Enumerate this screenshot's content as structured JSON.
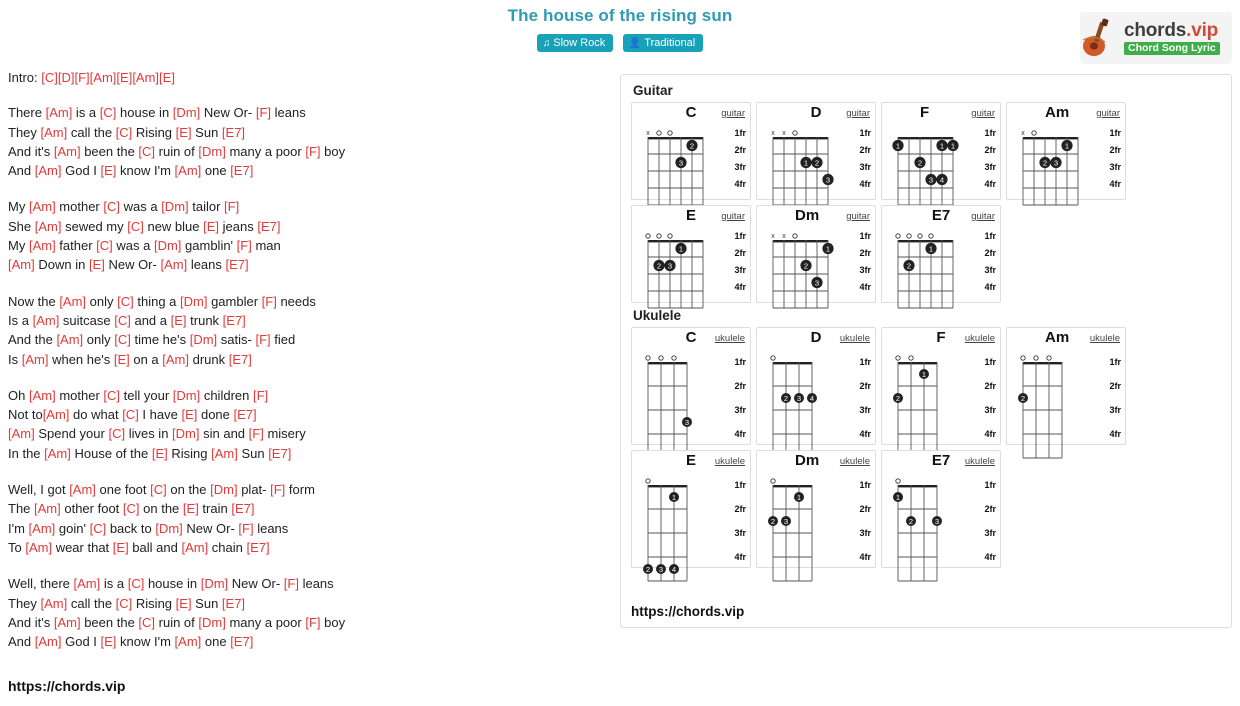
{
  "title": "The house of the rising sun",
  "badges": [
    {
      "icon": "metronome-icon",
      "label": "Slow Rock"
    },
    {
      "icon": "user-icon",
      "label": "Traditional"
    }
  ],
  "brand": {
    "name_main": "chords",
    "name_tld": ".vip",
    "tagline": "Chord Song Lyric",
    "icon": "ukulele-icon"
  },
  "site_link": "https://chords.vip",
  "panel_link": "https://chords.vip",
  "intro": "Intro: [C][D][F][Am][E][Am][E]",
  "verses": [
    [
      "There [Am] is a [C] house in [Dm] New Or- [F] leans",
      "They [Am] call the [C] Rising [E] Sun [E7]",
      "And it's [Am] been the [C] ruin of [Dm] many a poor [F] boy",
      "And [Am] God I [E] know I'm [Am] one [E7]"
    ],
    [
      "My [Am] mother [C] was a [Dm] tailor [F]",
      "She [Am] sewed my [C] new blue [E] jeans [E7]",
      "My [Am] father [C] was a [Dm] gamblin' [F] man",
      "[Am] Down in [E] New Or- [Am] leans [E7]"
    ],
    [
      "Now the [Am] only [C] thing a [Dm] gambler [F] needs",
      "Is a [Am] suitcase [C] and a [E] trunk [E7]",
      "And the [Am] only [C] time he's [Dm] satis- [F] fied",
      "Is [Am] when he's [E] on a [Am] drunk [E7]"
    ],
    [
      "Oh [Am] mother [C] tell your [Dm] children [F]",
      "Not to[Am] do what [C] I have [E] done [E7]",
      "[Am] Spend your [C] lives in [Dm] sin and [F] misery",
      "In the [Am] House of the [E] Rising [Am] Sun [E7]"
    ],
    [
      "Well, I got [Am] one foot [C] on the [Dm] plat- [F] form",
      "The [Am] other foot [C] on the [E] train [E7]",
      "I'm [Am] goin' [C] back to [Dm] New Or- [F] leans",
      "To [Am] wear that [E] ball and [Am] chain [E7]"
    ],
    [
      "Well, there [Am] is a [C] house in [Dm] New Or- [F] leans",
      "They [Am] call the [C] Rising [E] Sun [E7]",
      "And it's [Am] been the [C] ruin of [Dm] many a poor [F] boy",
      "And [Am] God I [E] know I'm [Am] one [E7]"
    ]
  ],
  "fret_labels": [
    "1fr",
    "2fr",
    "3fr",
    "4fr"
  ],
  "sections": [
    {
      "title": "Guitar",
      "instrument_label": "guitar",
      "rows": [
        [
          {
            "name": "C",
            "top": "x      o      o",
            "dots": [
              [
                1,
                "2",
                2
              ],
              [
                2,
                "3",
                3
              ]
            ],
            "label_shift": false
          },
          {
            "name": "D",
            "top": "x  x   o",
            "dots": [
              [
                2,
                "1",
                3
              ],
              [
                2,
                "2",
                2
              ],
              [
                3,
                "3",
                1
              ]
            ],
            "label_shift": false
          },
          {
            "name": "F",
            "top": "",
            "dots": [
              [
                1,
                "1",
                6
              ],
              [
                1,
                "1",
                2
              ],
              [
                1,
                "1",
                1
              ],
              [
                2,
                "2",
                4
              ],
              [
                3,
                "3",
                3
              ],
              [
                3,
                "4",
                2
              ]
            ],
            "label_shift": true
          },
          {
            "name": "Am",
            "top": "x  o",
            "dots": [
              [
                1,
                "1",
                2
              ],
              [
                2,
                "2",
                4
              ],
              [
                2,
                "3",
                3
              ]
            ],
            "label_shift": true
          }
        ],
        [
          {
            "name": "E",
            "top": "o        o  o",
            "dots": [
              [
                1,
                "1",
                3
              ],
              [
                2,
                "2",
                5
              ],
              [
                2,
                "3",
                4
              ]
            ],
            "label_shift": false
          },
          {
            "name": "Dm",
            "top": "x  x   o",
            "dots": [
              [
                1,
                "1",
                1
              ],
              [
                2,
                "2",
                3
              ],
              [
                3,
                "3",
                2
              ]
            ],
            "label_shift": true
          },
          {
            "name": "E7",
            "top": "o     o     o  o",
            "dots": [
              [
                1,
                "1",
                3
              ],
              [
                2,
                "2",
                5
              ]
            ],
            "label_shift": false
          }
        ]
      ]
    },
    {
      "title": "Ukulele",
      "instrument_label": "ukulele",
      "rows": [
        [
          {
            "name": "C",
            "top": "o  o  o",
            "dots": [
              [
                3,
                "3",
                1
              ]
            ],
            "label_shift": false
          },
          {
            "name": "D",
            "top": "o",
            "dots": [
              [
                2,
                "2",
                3
              ],
              [
                2,
                "3",
                2
              ],
              [
                2,
                "4",
                1
              ]
            ],
            "label_shift": false
          },
          {
            "name": "F",
            "top": "o  o",
            "dots": [
              [
                1,
                "1",
                2
              ],
              [
                2,
                "2",
                4
              ]
            ],
            "label_shift": false
          },
          {
            "name": "Am",
            "top": "o  o  o",
            "dots": [
              [
                2,
                "2",
                4
              ]
            ],
            "label_shift": true
          }
        ],
        [
          {
            "name": "E",
            "top": "o",
            "dots": [
              [
                1,
                "1",
                2
              ],
              [
                4,
                "2",
                4
              ],
              [
                4,
                "3",
                3
              ],
              [
                4,
                "4",
                2
              ]
            ],
            "label_shift": false
          },
          {
            "name": "Dm",
            "top": "o",
            "dots": [
              [
                2,
                "2",
                4
              ],
              [
                2,
                "3",
                3
              ],
              [
                1,
                "1",
                2
              ]
            ],
            "label_shift": true
          },
          {
            "name": "E7",
            "top": "o",
            "dots": [
              [
                1,
                "1",
                4
              ],
              [
                2,
                "2",
                3
              ],
              [
                2,
                "3",
                1
              ]
            ],
            "label_shift": false
          }
        ]
      ]
    }
  ]
}
